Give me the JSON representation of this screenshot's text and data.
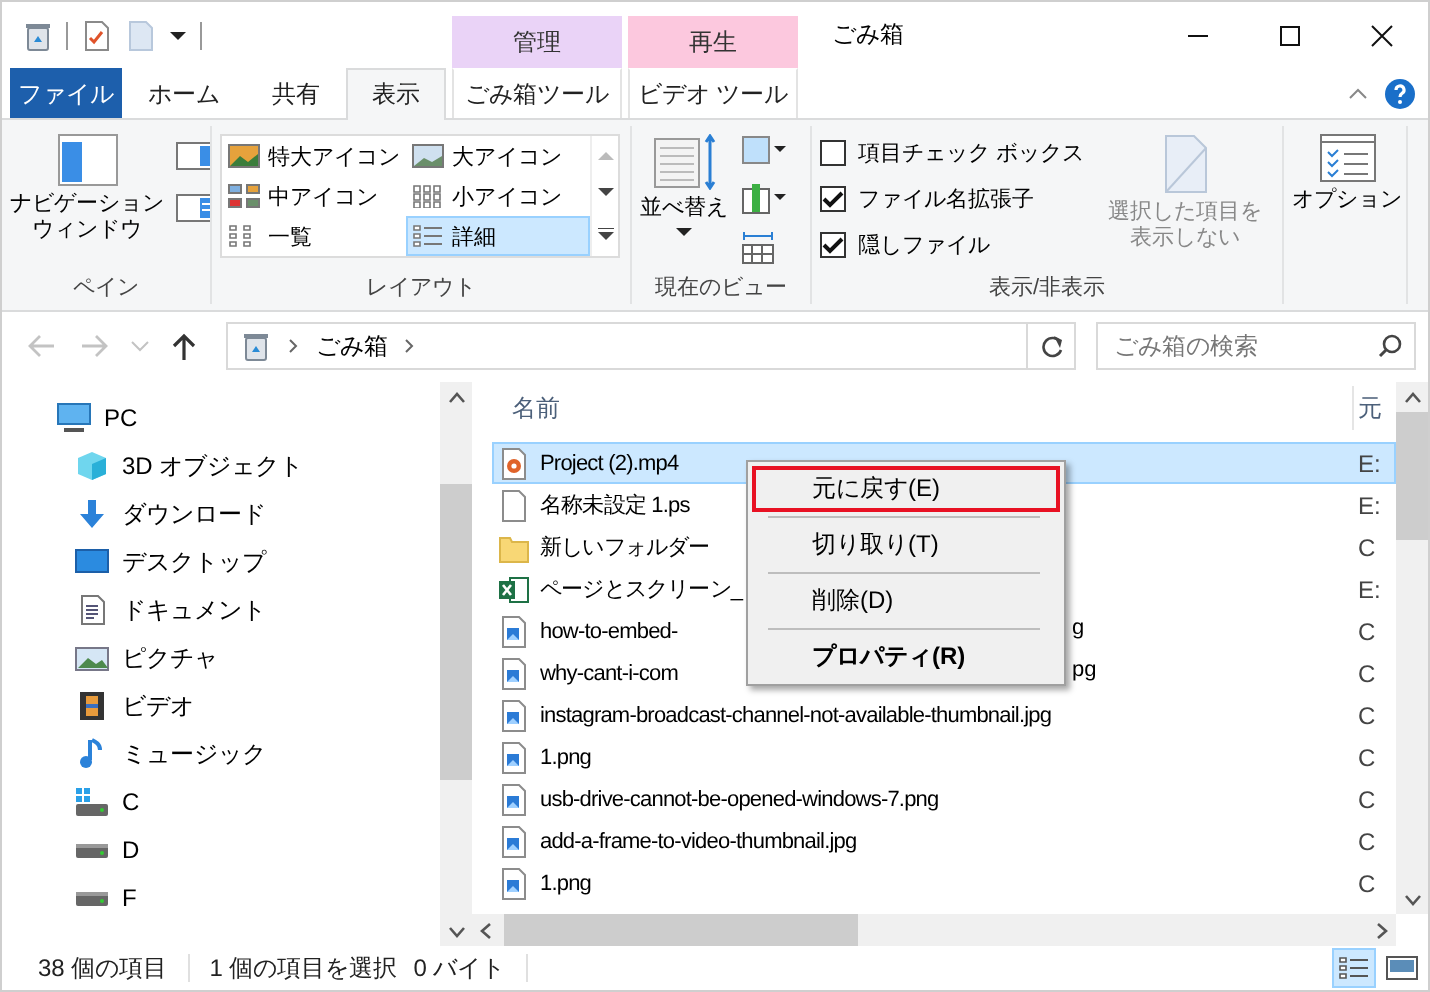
{
  "title_bar": {
    "title": "ごみ箱",
    "context_headers": [
      {
        "label": "管理",
        "color": "#ead3f7"
      },
      {
        "label": "再生",
        "color": "#fcc8de"
      }
    ]
  },
  "tabs": [
    {
      "label": "ファイル",
      "kind": "file",
      "selected": false
    },
    {
      "label": "ホーム",
      "kind": "normal",
      "selected": false
    },
    {
      "label": "共有",
      "kind": "normal",
      "selected": false
    },
    {
      "label": "表示",
      "kind": "normal",
      "selected": true
    },
    {
      "label": "ごみ箱ツール",
      "kind": "context",
      "selected": false
    },
    {
      "label": "ビデオ ツール",
      "kind": "context",
      "selected": false
    }
  ],
  "ribbon": {
    "pane": {
      "label": "ペイン",
      "nav_button": "ナビゲーションウィンドウ"
    },
    "layout": {
      "label": "レイアウト",
      "items": [
        {
          "label": "特大アイコン",
          "kind": "huge",
          "selected": false
        },
        {
          "label": "大アイコン",
          "kind": "large",
          "selected": false
        },
        {
          "label": "中アイコン",
          "kind": "medium",
          "selected": false
        },
        {
          "label": "小アイコン",
          "kind": "small",
          "selected": false
        },
        {
          "label": "一覧",
          "kind": "list",
          "selected": false
        },
        {
          "label": "詳細",
          "kind": "details",
          "selected": true
        }
      ]
    },
    "current_view": {
      "label": "現在のビュー",
      "sort_button": "並べ替え"
    },
    "show_hide": {
      "label": "表示/非表示",
      "checkboxes": [
        {
          "label": "項目チェック ボックス",
          "checked": false
        },
        {
          "label": "ファイル名拡張子",
          "checked": true
        },
        {
          "label": "隠しファイル",
          "checked": true
        }
      ],
      "hide_button": {
        "label": "選択した項目を表示しない",
        "disabled": true
      }
    },
    "options": {
      "button": "オプション"
    }
  },
  "address_bar": {
    "path": [
      "ごみ箱"
    ],
    "search_placeholder": "ごみ箱の検索"
  },
  "navigation": {
    "items": [
      {
        "label": "PC",
        "kind": "pc",
        "children": [
          {
            "label": "3D オブジェクト",
            "kind": "cube"
          },
          {
            "label": "ダウンロード",
            "kind": "download"
          },
          {
            "label": "デスクトップ",
            "kind": "desktop"
          },
          {
            "label": "ドキュメント",
            "kind": "document"
          },
          {
            "label": "ピクチャ",
            "kind": "picture"
          },
          {
            "label": "ビデオ",
            "kind": "video"
          },
          {
            "label": "ミュージック",
            "kind": "music"
          },
          {
            "label": "C",
            "kind": "system"
          },
          {
            "label": "D",
            "kind": "drive"
          },
          {
            "label": "F",
            "kind": "drive"
          }
        ]
      }
    ]
  },
  "files": {
    "columns": [
      "名前",
      "元"
    ],
    "rows": [
      {
        "name": "Project (2).mp4",
        "kind": "video",
        "column_2": "E:",
        "selected": true
      },
      {
        "name": "名称未設定 1.ps",
        "kind": "blank",
        "column_2": "E:",
        "selected": false
      },
      {
        "name": "新しいフォルダー",
        "kind": "folder",
        "column_2": "C",
        "selected": false
      },
      {
        "name": "ページとスクリーン_",
        "kind": "excel",
        "column_2": "E:",
        "selected": false
      },
      {
        "name": "how-to-embed-",
        "tail": "g",
        "kind": "image",
        "column_2": "C",
        "selected": false
      },
      {
        "name": "why-cant-i-com",
        "tail": "pg",
        "kind": "image",
        "column_2": "C",
        "selected": false
      },
      {
        "name": "instagram-broadcast-channel-not-available-thumbnail.jpg",
        "kind": "image",
        "column_2": "C",
        "selected": false
      },
      {
        "name": "1.png",
        "kind": "image",
        "column_2": "C",
        "selected": false
      },
      {
        "name": "usb-drive-cannot-be-opened-windows-7.png",
        "kind": "image",
        "column_2": "C",
        "selected": false
      },
      {
        "name": "add-a-frame-to-video-thumbnail.jpg",
        "kind": "image",
        "column_2": "C",
        "selected": false
      },
      {
        "name": "1.png",
        "kind": "image",
        "column_2": "C",
        "selected": false
      }
    ]
  },
  "context_menu": {
    "items": [
      {
        "label": "元に戻す(E)",
        "highlighted": true,
        "default": false
      },
      {
        "label": "切り取り(T)",
        "highlighted": false,
        "default": false
      },
      {
        "label": "削除(D)",
        "highlighted": false,
        "default": false
      },
      {
        "label": "プロパティ(R)",
        "highlighted": false,
        "default": true
      }
    ]
  },
  "status_bar": {
    "item_count": "38 個の項目",
    "selection": "1 個の項目を選択",
    "size": "0 バイト",
    "views": [
      {
        "kind": "details",
        "selected": true
      },
      {
        "kind": "icons",
        "selected": false
      }
    ]
  }
}
